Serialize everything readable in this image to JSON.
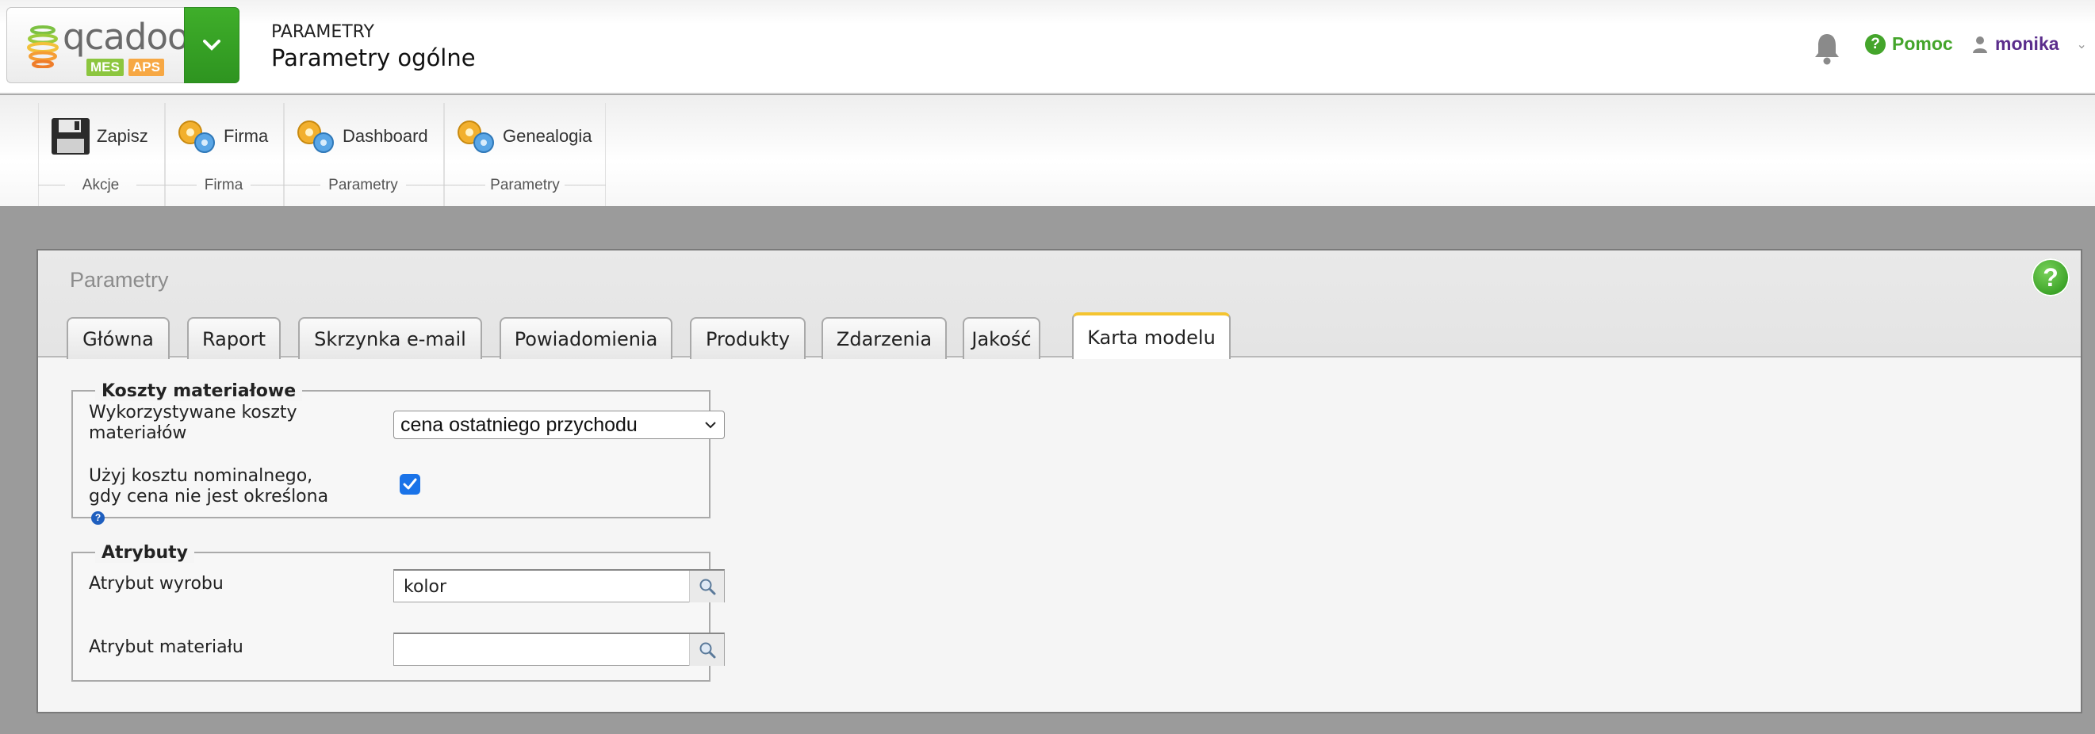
{
  "header": {
    "logo": {
      "word": "qcadoo",
      "tag_mes": "MES",
      "tag_aps": "APS"
    },
    "breadcrumb": "PARAMETRY",
    "title": "Parametry ogólne",
    "help_label": "Pomoc",
    "user_name": "monika"
  },
  "ribbon": {
    "groups": [
      {
        "button": "Zapisz",
        "label": "Akcje",
        "icon": "floppy-disk-icon"
      },
      {
        "button": "Firma",
        "label": "Firma",
        "icon": "gears-icon"
      },
      {
        "button": "Dashboard",
        "label": "Parametry",
        "icon": "gears-icon"
      },
      {
        "button": "Genealogia",
        "label": "Parametry",
        "icon": "gears-icon"
      }
    ]
  },
  "panel": {
    "title": "Parametry",
    "help_icon": "?",
    "tabs": [
      "Główna",
      "Raport",
      "Skrzynka e-mail",
      "Powiadomienia",
      "Produkty",
      "Zdarzenia",
      "Jakość",
      "Karta modelu"
    ],
    "active_tab": "Karta modelu"
  },
  "material_costs": {
    "legend": "Koszty materiałowe",
    "used_costs_label": "Wykorzystywane koszty materiałów",
    "used_costs_value": "cena ostatniego przychodu",
    "nominal_label": "Użyj kosztu nominalnego, gdy cena nie jest określona",
    "nominal_checked": true
  },
  "attributes": {
    "legend": "Atrybuty",
    "product_attr_label": "Atrybut wyrobu",
    "product_attr_value": "kolor",
    "material_attr_label": "Atrybut materiału",
    "material_attr_value": ""
  },
  "colors": {
    "accent_green": "#3aa226",
    "user_purple": "#5b2d8c",
    "active_tab_border": "#f4c430",
    "checkbox_blue": "#1a73e8"
  }
}
